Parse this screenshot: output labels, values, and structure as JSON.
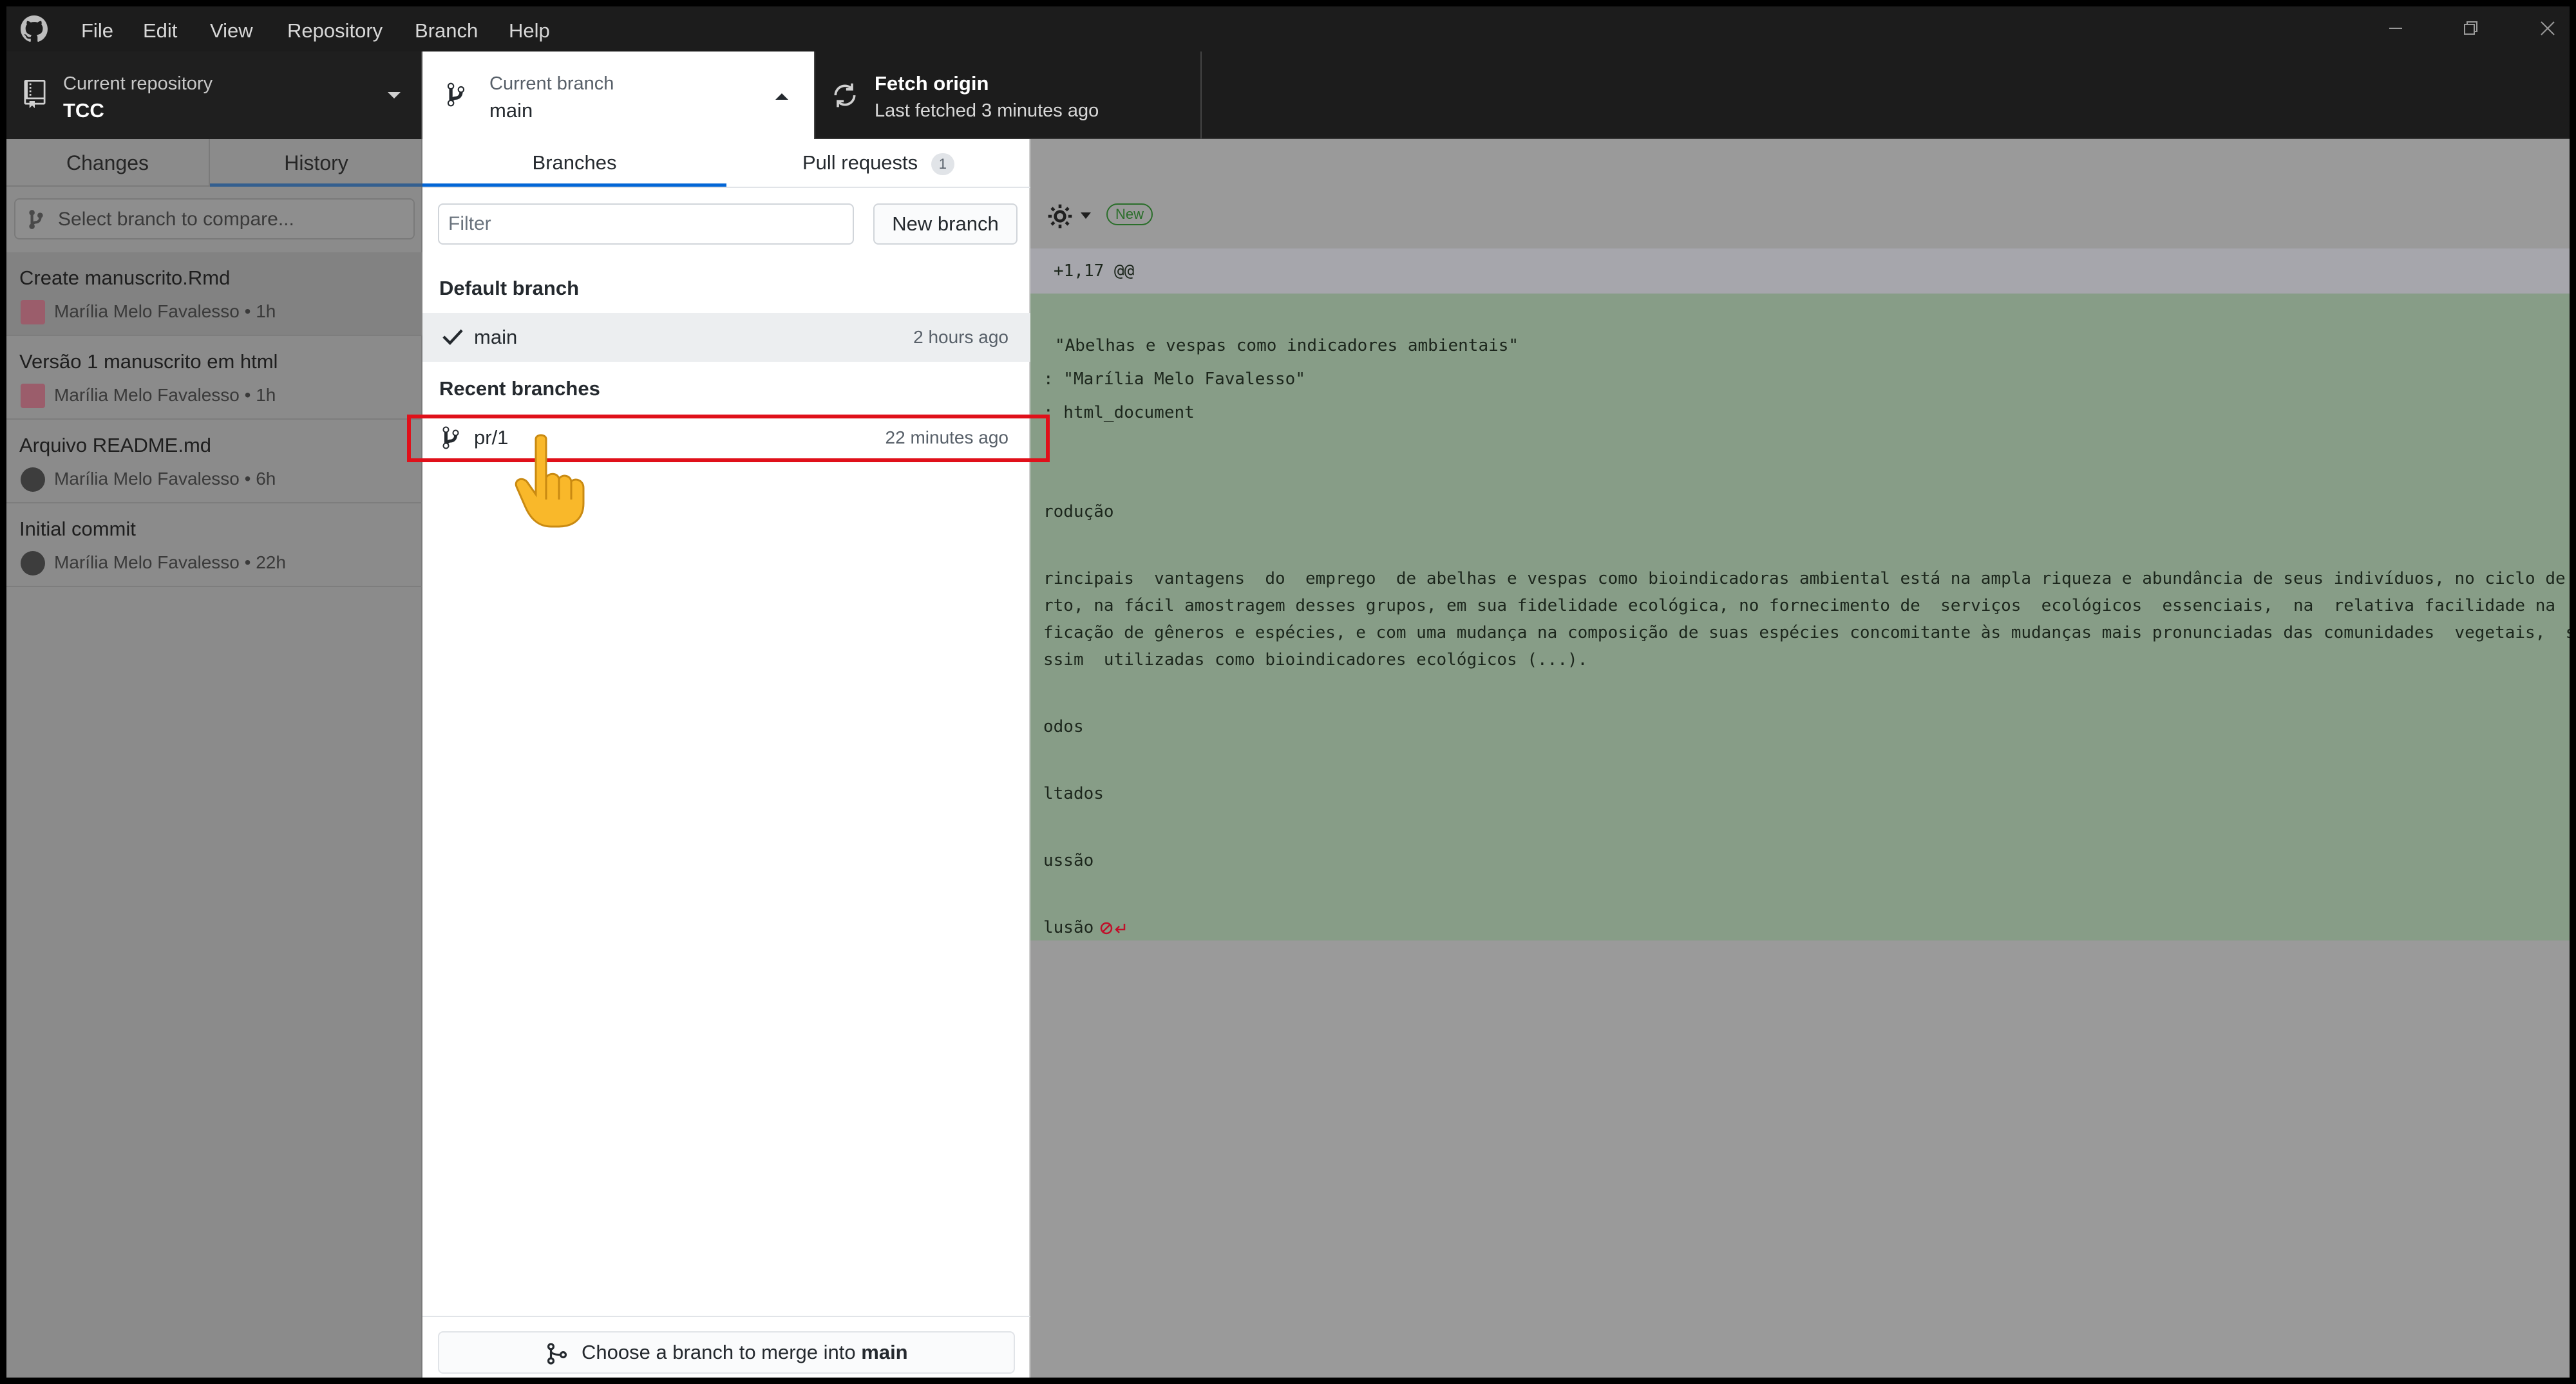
{
  "menu": [
    "File",
    "Edit",
    "View",
    "Repository",
    "Branch",
    "Help"
  ],
  "toolbar": {
    "repo_label": "Current repository",
    "repo_value": "TCC",
    "branch_label": "Current branch",
    "branch_value": "main",
    "fetch_title": "Fetch origin",
    "fetch_sub": "Last fetched 3 minutes ago"
  },
  "sidebar": {
    "tabs": [
      "Changes",
      "History"
    ],
    "compare_placeholder": "Select branch to compare...",
    "commits": [
      {
        "title": "Create manuscrito.Rmd",
        "meta": "Marília Melo Favalesso • 1h"
      },
      {
        "title": "Versão 1 manuscrito em html",
        "meta": "Marília Melo Favalesso • 1h"
      },
      {
        "title": "Arquivo README.md",
        "meta": "Marília Melo Favalesso • 6h"
      },
      {
        "title": "Initial commit",
        "meta": "Marília Melo Favalesso • 22h"
      }
    ]
  },
  "dropdown": {
    "tabs": {
      "branches": "Branches",
      "pulls": "Pull requests",
      "pulls_count": "1"
    },
    "filter_placeholder": "Filter",
    "new_branch": "New branch",
    "default_heading": "Default branch",
    "default_branch": {
      "name": "main",
      "time": "2 hours ago"
    },
    "recent_heading": "Recent branches",
    "recent_branch": {
      "name": "pr/1",
      "time": "22 minutes ago"
    },
    "merge_prefix": "Choose a branch to merge into",
    "merge_target": "main"
  },
  "diff": {
    "new_badge": "New",
    "hunk": "+1,17 @@",
    "lines": [
      "\"Abelhas e vespas como indicadores ambientais\"",
      ": \"Marília Melo Favalesso\"",
      ": html_document",
      "rodução",
      "rincipais  vantagens  do  emprego  de abelhas e vespas como bioindicadoras ambiental está na ampla riqueza e abundância de seus indivíduos, no ciclo de",
      "rto, na fácil amostragem desses grupos, em sua fidelidade ecológica, no fornecimento de  serviços  ecológicos  essenciais,  na  relativa facilidade na",
      "ficação de gêneros e espécies, e com uma mudança na composição de suas espécies concomitante às mudanças mais pronunciadas das comunidades  vegetais,  s",
      "ssim  utilizadas como bioindicadores ecológicos (...).",
      "odos",
      "ltados",
      "ussão",
      "lusão"
    ]
  }
}
